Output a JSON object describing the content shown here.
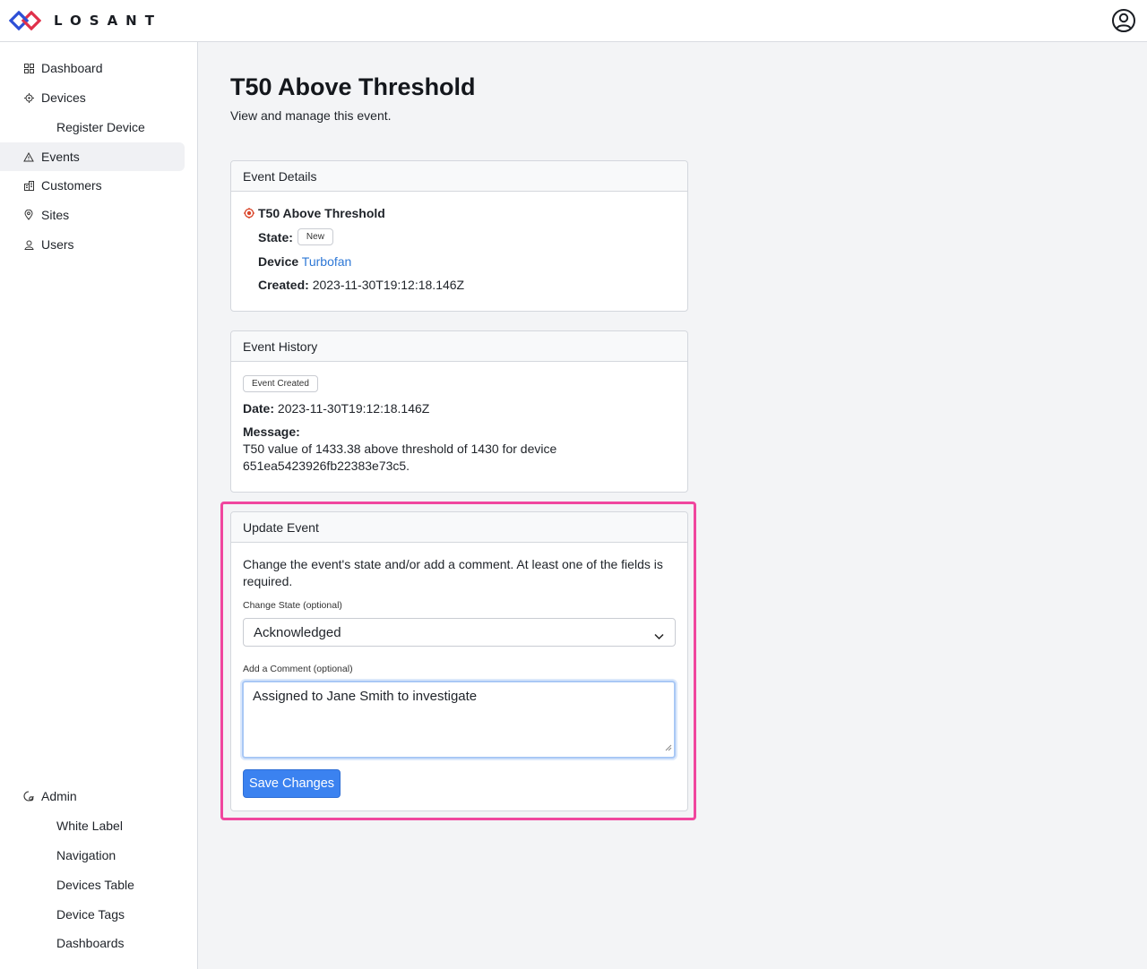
{
  "brand": {
    "name": "LOSANT"
  },
  "sidebar": {
    "items": [
      {
        "label": "Dashboard",
        "icon": "grid-icon"
      },
      {
        "label": "Devices",
        "icon": "chip-icon"
      },
      {
        "label": "Register Device"
      },
      {
        "label": "Events",
        "icon": "warning-icon"
      },
      {
        "label": "Customers",
        "icon": "building-icon"
      },
      {
        "label": "Sites",
        "icon": "pin-icon"
      },
      {
        "label": "Users",
        "icon": "user-icon"
      }
    ],
    "admin": {
      "label": "Admin",
      "icon": "admin-gear-icon",
      "items": [
        {
          "label": "White Label"
        },
        {
          "label": "Navigation"
        },
        {
          "label": "Devices Table"
        },
        {
          "label": "Device Tags"
        },
        {
          "label": "Dashboards"
        }
      ]
    }
  },
  "page": {
    "title": "T50 Above Threshold",
    "subtitle": "View and manage this event."
  },
  "details": {
    "header": "Event Details",
    "event_name": "T50 Above Threshold",
    "state_label": "State:",
    "state_value": "New",
    "device_label": "Device",
    "device_value": "Turbofan",
    "created_label": "Created:",
    "created_value": "2023-11-30T19:12:18.146Z"
  },
  "history": {
    "header": "Event History",
    "badge": "Event Created",
    "date_label": "Date:",
    "date_value": "2023-11-30T19:12:18.146Z",
    "message_label": "Message:",
    "message_line1": "T50 value of 1433.38 above threshold of 1430 for device",
    "message_line2": "651ea5423926fb22383e73c5."
  },
  "update": {
    "header": "Update Event",
    "description_line1": "Change the event's state and/or add a comment. At least one of the fields is",
    "description_line2": "required.",
    "state_field_label": "Change State (optional)",
    "state_selected": "Acknowledged",
    "comment_field_label": "Add a Comment (optional)",
    "comment_value": "Assigned to Jane Smith to investigate",
    "save_label": "Save Changes"
  },
  "colors": {
    "accent": "#3b82f0",
    "link": "#2e78d6",
    "highlight": "#f0469e",
    "event_icon": "#d9462b"
  }
}
